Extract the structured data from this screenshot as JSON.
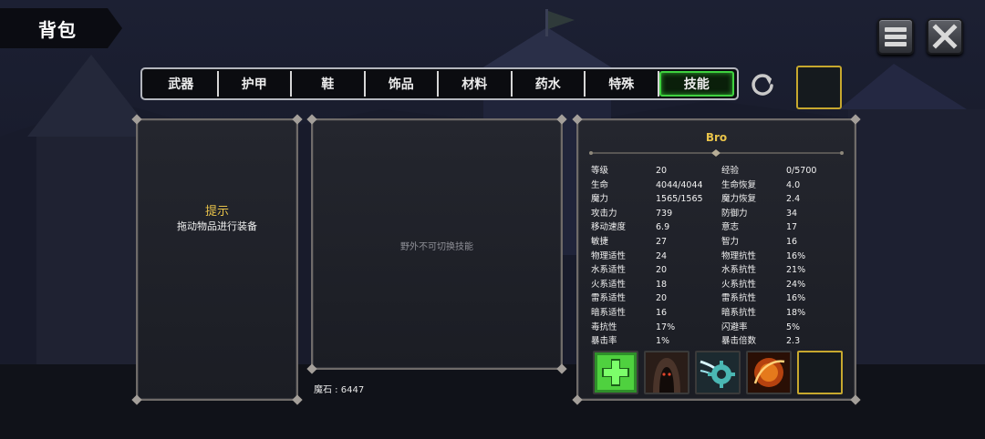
{
  "header": {
    "title": "背包"
  },
  "tabs": [
    {
      "label": "武器",
      "active": false
    },
    {
      "label": "护甲",
      "active": false
    },
    {
      "label": "鞋",
      "active": false
    },
    {
      "label": "饰品",
      "active": false
    },
    {
      "label": "材料",
      "active": false
    },
    {
      "label": "药水",
      "active": false
    },
    {
      "label": "特殊",
      "active": false
    },
    {
      "label": "技能",
      "active": true
    }
  ],
  "hint": {
    "title": "提示",
    "text": "拖动物品进行装备"
  },
  "skill_area": {
    "message": "野外不可切换技能"
  },
  "currency": {
    "gems_label": "魔石 : 6447"
  },
  "character": {
    "name": "Bro",
    "stats": [
      [
        "等级",
        "20",
        "经验",
        "0/5700"
      ],
      [
        "生命",
        "4044/4044",
        "生命恢复",
        "4.0"
      ],
      [
        "魔力",
        "1565/1565",
        "魔力恢复",
        "2.4"
      ],
      [
        "攻击力",
        "739",
        "防御力",
        "34"
      ],
      [
        "移动速度",
        "6.9",
        "意志",
        "17"
      ],
      [
        "敏捷",
        "27",
        "智力",
        "16"
      ],
      [
        "物理适性",
        "24",
        "物理抗性",
        "16%"
      ],
      [
        "水系适性",
        "20",
        "水系抗性",
        "21%"
      ],
      [
        "火系适性",
        "18",
        "火系抗性",
        "24%"
      ],
      [
        "雷系适性",
        "20",
        "雷系抗性",
        "16%"
      ],
      [
        "暗系适性",
        "16",
        "暗系抗性",
        "18%"
      ],
      [
        "毒抗性",
        "17%",
        "闪避率",
        "5%"
      ],
      [
        "暴击率",
        "1%",
        "暴击倍数",
        "2.3"
      ]
    ],
    "skills": [
      {
        "icon": "heal-cross-icon"
      },
      {
        "icon": "hooded-figure-icon"
      },
      {
        "icon": "gear-vortex-icon"
      },
      {
        "icon": "fire-orb-icon"
      },
      {
        "icon": "empty-slot"
      }
    ]
  },
  "colors": {
    "accent_gold": "#e8c34a",
    "active_tab_border": "#3fd13f",
    "slot_border": "#c7a82e"
  }
}
